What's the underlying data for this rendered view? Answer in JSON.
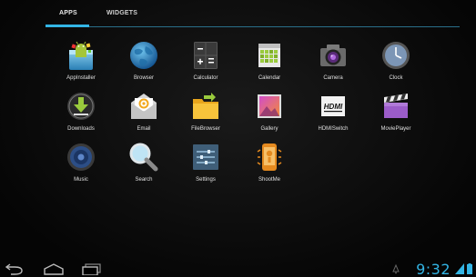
{
  "tabs": {
    "apps": "APPS",
    "widgets": "WIDGETS"
  },
  "apps": [
    {
      "label": "AppInstaller",
      "icon": "android-installer-icon"
    },
    {
      "label": "Browser",
      "icon": "globe-icon"
    },
    {
      "label": "Calculator",
      "icon": "calculator-icon"
    },
    {
      "label": "Calendar",
      "icon": "calendar-icon"
    },
    {
      "label": "Camera",
      "icon": "camera-icon"
    },
    {
      "label": "Clock",
      "icon": "clock-icon"
    },
    {
      "label": "Downloads",
      "icon": "download-icon"
    },
    {
      "label": "Email",
      "icon": "email-icon"
    },
    {
      "label": "FileBrowser",
      "icon": "folder-icon"
    },
    {
      "label": "Gallery",
      "icon": "gallery-icon"
    },
    {
      "label": "HDMISwitch",
      "icon": "hdmi-icon"
    },
    {
      "label": "MoviePlayer",
      "icon": "clapperboard-icon"
    },
    {
      "label": "Music",
      "icon": "speaker-icon"
    },
    {
      "label": "Search",
      "icon": "magnifier-icon"
    },
    {
      "label": "Settings",
      "icon": "sliders-icon"
    },
    {
      "label": "ShootMe",
      "icon": "shootme-icon"
    }
  ],
  "hdmi_text": "HDMI",
  "status": {
    "time": "9:32"
  },
  "colors": {
    "accent": "#33b5e5",
    "background": "#000000"
  }
}
